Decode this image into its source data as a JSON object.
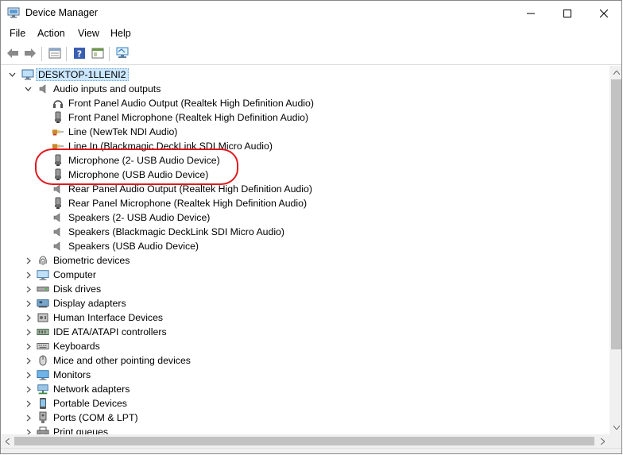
{
  "window": {
    "title": "Device Manager",
    "title_icon": "device-manager-icon"
  },
  "caption_buttons": [
    "minimize-icon",
    "maximize-icon",
    "close-icon"
  ],
  "menu": [
    "File",
    "Action",
    "View",
    "Help"
  ],
  "toolbar": [
    "back-icon",
    "forward-icon",
    "properties-icon",
    "help-icon",
    "show-hide-icon",
    "scan-hardware-icon"
  ],
  "tree": {
    "root": "DESKTOP-1LLENI2",
    "audio": {
      "label": "Audio inputs and outputs",
      "children": [
        {
          "label": "Front Panel Audio Output (Realtek High Definition Audio)",
          "icon": "headphones-icon"
        },
        {
          "label": "Front Panel Microphone (Realtek High Definition Audio)",
          "icon": "microphone-icon"
        },
        {
          "label": "Line (NewTek NDI Audio)",
          "icon": "audio-jack-icon"
        },
        {
          "label": "Line In (Blackmagic DeckLink SDI Micro Audio)",
          "icon": "audio-jack-icon"
        },
        {
          "label": "Microphone (2- USB Audio Device)",
          "icon": "microphone-icon"
        },
        {
          "label": "Microphone (USB Audio Device)",
          "icon": "microphone-icon"
        },
        {
          "label": "Rear Panel Audio Output (Realtek High Definition Audio)",
          "icon": "speaker-icon"
        },
        {
          "label": "Rear Panel Microphone (Realtek High Definition Audio)",
          "icon": "microphone-icon"
        },
        {
          "label": "Speakers (2- USB Audio Device)",
          "icon": "speaker-icon"
        },
        {
          "label": "Speakers (Blackmagic DeckLink SDI Micro Audio)",
          "icon": "speaker-icon"
        },
        {
          "label": "Speakers (USB Audio Device)",
          "icon": "speaker-icon"
        }
      ]
    },
    "categories": [
      {
        "label": "Biometric devices",
        "icon": "fingerprint-icon"
      },
      {
        "label": "Computer",
        "icon": "computer-icon"
      },
      {
        "label": "Disk drives",
        "icon": "disk-drive-icon"
      },
      {
        "label": "Display adapters",
        "icon": "display-adapter-icon"
      },
      {
        "label": "Human Interface Devices",
        "icon": "hid-icon"
      },
      {
        "label": "IDE ATA/ATAPI controllers",
        "icon": "ide-controller-icon"
      },
      {
        "label": "Keyboards",
        "icon": "keyboard-icon"
      },
      {
        "label": "Mice and other pointing devices",
        "icon": "mouse-icon"
      },
      {
        "label": "Monitors",
        "icon": "monitor-icon"
      },
      {
        "label": "Network adapters",
        "icon": "network-adapter-icon"
      },
      {
        "label": "Portable Devices",
        "icon": "portable-device-icon"
      },
      {
        "label": "Ports (COM & LPT)",
        "icon": "port-icon"
      },
      {
        "label": "Print queues",
        "icon": "printer-icon"
      }
    ]
  },
  "colors": {
    "selection": "#cce8ff",
    "annotation": "#e0191e",
    "accent": "#1f6fc5"
  }
}
